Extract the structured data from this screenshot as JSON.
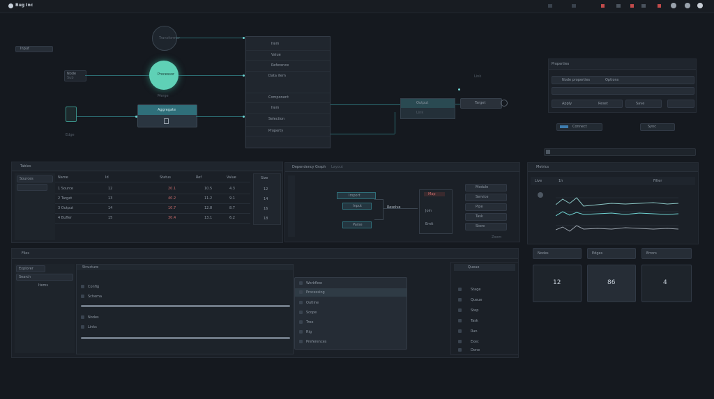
{
  "topbar": {
    "app_title": "Bug Inc"
  },
  "canvas": {
    "left_tag": "Input",
    "left_mini": [
      "Node",
      "Sub"
    ],
    "mid_label": "Edge",
    "selected_node": "Transformer",
    "primary_node": "Processor",
    "hub_node": "Aggregate",
    "hub_sub": "Merge",
    "list_items": [
      "Item",
      "Value",
      "Reference",
      "Data item",
      "Component",
      "Item",
      "Selection",
      "Property"
    ],
    "out_nodes": [
      "Output",
      "Link"
    ],
    "out_small_label": "Target"
  },
  "settings_panel": {
    "title": "Properties",
    "field1": "Node properties",
    "field2": "Options",
    "btn1": "Apply",
    "btn2": "Reset",
    "btn3": "Save",
    "chip1": "Connect",
    "chip2": "Sync"
  },
  "table_panel": {
    "title": "Tables",
    "sidebar": [
      "Sources"
    ],
    "headers": [
      "Name",
      "Id",
      "Status",
      "Ref",
      "Value",
      "Size"
    ],
    "rows": [
      [
        "1 Source",
        "12",
        "20.1",
        "10.5",
        "4.3",
        "12"
      ],
      [
        "2 Target",
        "13",
        "40.2",
        "11.2",
        "9.1",
        "14"
      ],
      [
        "3 Output",
        "14",
        "10.7",
        "12.8",
        "8.7",
        "16"
      ],
      [
        "4 Buffer",
        "15",
        "30.4",
        "13.1",
        "6.2",
        "18"
      ]
    ]
  },
  "graph_panel": {
    "title": "Dependency Graph",
    "tab2": "Layout",
    "nodes_left": [
      "Import",
      "Input",
      "Parse"
    ],
    "center": "Resolve",
    "nodes_right": [
      "Map",
      "Join",
      "Emit"
    ],
    "legend": [
      "Module",
      "Service",
      "Pipe",
      "Task",
      "Store"
    ],
    "footer": "Zoom"
  },
  "chart_panel": {
    "title": "Metrics",
    "tabs": [
      "Live",
      "1h"
    ],
    "filter": "Filter"
  },
  "stat_cards": [
    {
      "label": "Nodes",
      "value": "12"
    },
    {
      "label": "Edges",
      "value": "86"
    },
    {
      "label": "Errors",
      "value": "4"
    }
  ],
  "lower_left": {
    "title": "Files",
    "side_items": [
      "Explorer",
      "Search",
      "Items"
    ],
    "tree_title": "Structure",
    "tree_rows": [
      "Config",
      "Schema",
      "Nodes",
      "Links"
    ]
  },
  "dropdown": {
    "items": [
      "Workflow",
      "Processing",
      "Outline",
      "Scope",
      "Tree",
      "Rig",
      "Preferences"
    ]
  },
  "side_list": {
    "title": "Queue",
    "rows": [
      "Stage",
      "Queue",
      "Step",
      "Task",
      "Run",
      "Exec",
      "Done"
    ]
  },
  "colors": {
    "accent": "#5fd1b6",
    "line": "#2c6d73",
    "bg": "#15191f"
  }
}
